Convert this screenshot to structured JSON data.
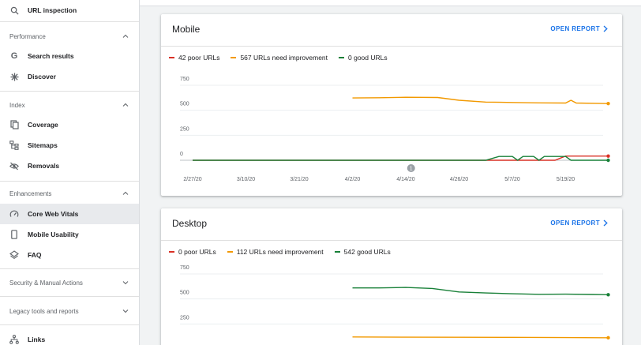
{
  "sidebar": {
    "url_inspection": "URL inspection",
    "performance_section": "Performance",
    "search_results": "Search results",
    "discover": "Discover",
    "index_section": "Index",
    "coverage": "Coverage",
    "sitemaps": "Sitemaps",
    "removals": "Removals",
    "enhancements_section": "Enhancements",
    "core_web_vitals": "Core Web Vitals",
    "mobile_usability": "Mobile Usability",
    "faq": "FAQ",
    "security_section": "Security & Manual Actions",
    "legacy_section": "Legacy tools and reports",
    "links": "Links"
  },
  "mobile": {
    "title": "Mobile",
    "link": "OPEN REPORT",
    "legend": [
      "42 poor URLs",
      "567 URLs need improvement",
      "0 good URLs"
    ]
  },
  "desktop": {
    "title": "Desktop",
    "link": "OPEN REPORT",
    "legend": [
      "0 poor URLs",
      "112 URLs need improvement",
      "542 good URLs"
    ]
  },
  "colors": {
    "poor": "#d93025",
    "improvement": "#f29900",
    "good": "#188038",
    "link": "#1a73e8"
  },
  "chart_data": [
    {
      "type": "line",
      "title": "Mobile",
      "x_ticks": [
        "2/27/20",
        "3/10/20",
        "3/21/20",
        "4/2/20",
        "4/14/20",
        "4/26/20",
        "5/7/20",
        "5/19/20"
      ],
      "y_ticks": [
        "750",
        "500",
        "250",
        "0"
      ],
      "ylim": [
        0,
        750
      ],
      "annotation": "1",
      "series": [
        {
          "name": "42 poor URLs",
          "color": "#d93025",
          "points": [
            [
              0,
              0
            ],
            [
              3,
              0
            ],
            [
              6.8,
              0
            ],
            [
              7,
              42
            ],
            [
              7.8,
              42
            ]
          ]
        },
        {
          "name": "567 URLs need improvement",
          "color": "#f29900",
          "points": [
            [
              3,
              623
            ],
            [
              3.5,
              625
            ],
            [
              4,
              630
            ],
            [
              4.6,
              628
            ],
            [
              5,
              600
            ],
            [
              5.5,
              582
            ],
            [
              6,
              578
            ],
            [
              6.5,
              574
            ],
            [
              7,
              572
            ],
            [
              7.1,
              600
            ],
            [
              7.2,
              572
            ],
            [
              7.8,
              567
            ]
          ]
        },
        {
          "name": "0 good URLs",
          "color": "#188038",
          "points": [
            [
              0,
              0
            ],
            [
              5.5,
              0
            ],
            [
              5.75,
              38
            ],
            [
              6,
              38
            ],
            [
              6.1,
              0
            ],
            [
              6.2,
              38
            ],
            [
              6.4,
              38
            ],
            [
              6.5,
              0
            ],
            [
              6.6,
              38
            ],
            [
              7,
              38
            ],
            [
              7.1,
              0
            ],
            [
              7.8,
              0
            ]
          ]
        }
      ]
    },
    {
      "type": "line",
      "title": "Desktop",
      "y_ticks": [
        "750",
        "500",
        "250"
      ],
      "ylim": [
        0,
        750
      ],
      "series": [
        {
          "name": "0 poor URLs",
          "color": "#d93025",
          "points": []
        },
        {
          "name": "112 URLs need improvement",
          "color": "#f29900",
          "points": [
            [
              3,
              120
            ],
            [
              4,
              118
            ],
            [
              5,
              117
            ],
            [
              6,
              116
            ],
            [
              7,
              114
            ],
            [
              7.8,
              112
            ]
          ]
        },
        {
          "name": "542 good URLs",
          "color": "#188038",
          "points": [
            [
              3,
              610
            ],
            [
              3.5,
              610
            ],
            [
              4,
              615
            ],
            [
              4.5,
              605
            ],
            [
              5,
              570
            ],
            [
              5.5,
              560
            ],
            [
              6,
              552
            ],
            [
              6.5,
              546
            ],
            [
              7,
              548
            ],
            [
              7.5,
              545
            ],
            [
              7.8,
              542
            ]
          ]
        }
      ]
    }
  ]
}
